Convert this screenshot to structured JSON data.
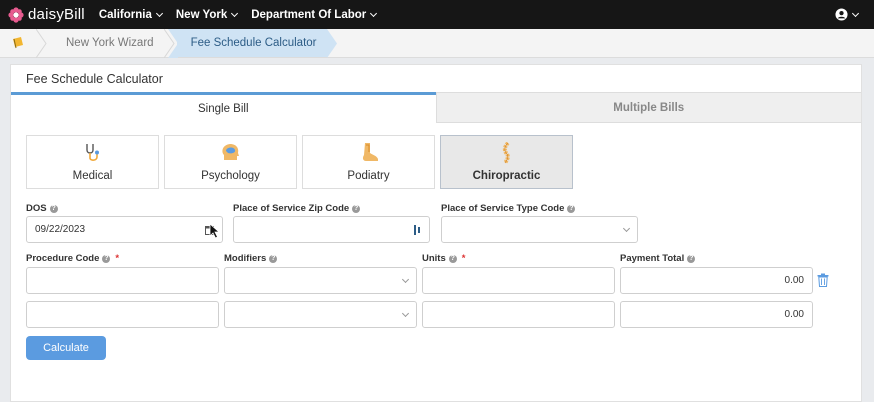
{
  "topnav": {
    "brand": "daisyBill",
    "menus": [
      "California",
      "New York",
      "Department Of Labor"
    ]
  },
  "breadcrumb": {
    "items": [
      "New York Wizard",
      "Fee Schedule Calculator"
    ]
  },
  "card": {
    "title": "Fee Schedule Calculator",
    "tabs": [
      "Single Bill",
      "Multiple Bills"
    ],
    "specialties": [
      "Medical",
      "Psychology",
      "Podiatry",
      "Chiropractic"
    ],
    "selected_specialty": "Chiropractic"
  },
  "form": {
    "dos_label": "DOS",
    "dos_value": "09/22/2023",
    "zip_label": "Place of Service Zip Code",
    "type_label": "Place of Service Type Code",
    "procedure_label": "Procedure Code",
    "modifiers_label": "Modifiers",
    "units_label": "Units",
    "payment_label": "Payment Total",
    "rows": [
      {
        "payment": "0.00"
      },
      {
        "payment": "0.00"
      }
    ],
    "calculate_label": "Calculate"
  },
  "colors": {
    "accent": "#5b9be0",
    "nav_bg": "#161616",
    "crumb_active": "#cfe3f4"
  }
}
